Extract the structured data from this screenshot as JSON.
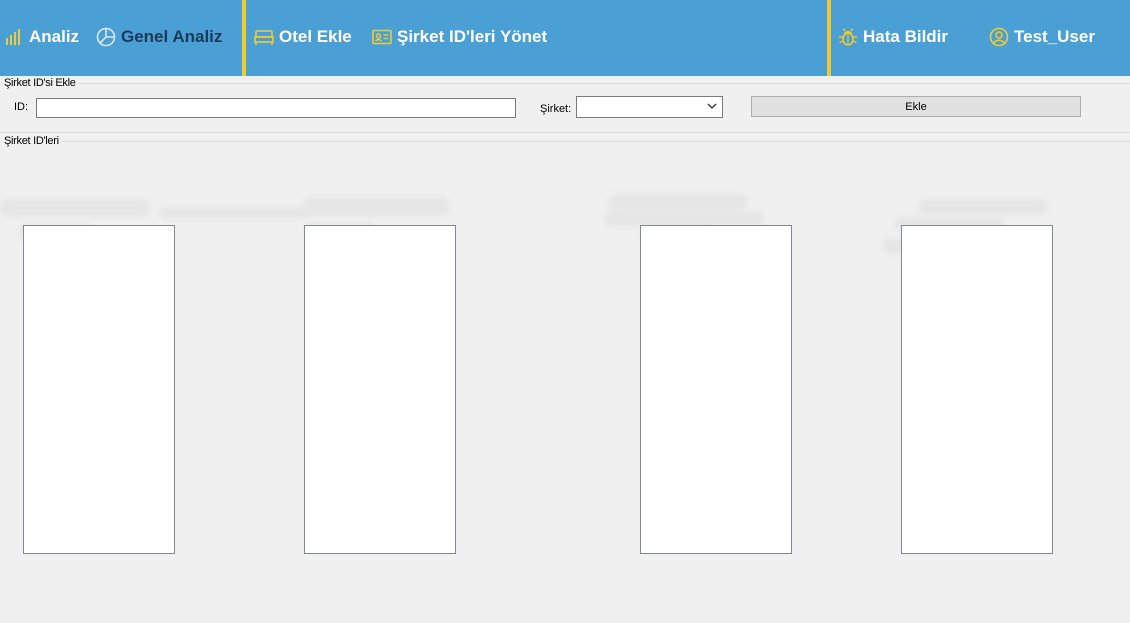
{
  "nav": {
    "analiz": "Analiz",
    "genel_analiz": "Genel Analiz",
    "otel_ekle": "Otel Ekle",
    "sirket_id_yonet": "Şirket ID'leri Yönet",
    "hata_bildir": "Hata Bildir",
    "user": "Test_User"
  },
  "add_group": {
    "title": "Şirket ID'si Ekle",
    "id_label": "ID:",
    "id_value": "",
    "company_label": "Şirket:",
    "company_value": "",
    "add_button": "Ekle"
  },
  "list_group": {
    "title": "Şirket ID'leri"
  },
  "icons": {
    "analiz": "bar-chart-icon",
    "genel_analiz": "pie-chart-icon",
    "otel_ekle": "bed-icon",
    "sirket_id_yonet": "id-card-icon",
    "hata_bildir": "bug-icon",
    "user": "user-circle-icon"
  },
  "colors": {
    "topbar": "#4a9fd4",
    "accent": "#f2cc2f",
    "active_text": "#1b3a5a",
    "window_bg": "#f0f0f0"
  }
}
